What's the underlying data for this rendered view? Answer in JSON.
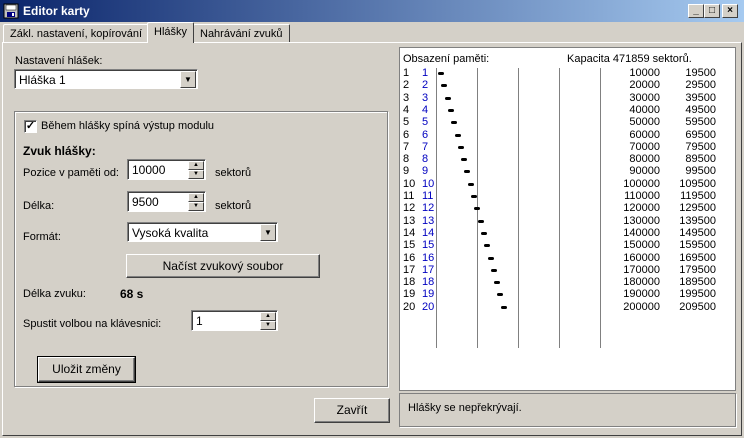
{
  "window": {
    "title": "Editor karty"
  },
  "tabs": [
    {
      "label": "Zákl. nastavení, kopírování"
    },
    {
      "label": "Hlášky"
    },
    {
      "label": "Nahrávání zvuků"
    }
  ],
  "form": {
    "settings_label": "Nastavení hlášek:",
    "settings_value": "Hláška 1",
    "checkbox_label": "Během hlášky spíná výstup modulu",
    "checkbox_checked": true,
    "sound_heading": "Zvuk hlášky:",
    "position_label": "Pozice v paměti od:",
    "position_value": "10000",
    "position_unit": "sektorů",
    "length_label": "Délka:",
    "length_value": "9500",
    "length_unit": "sektorů",
    "format_label": "Formát:",
    "format_value": "Vysoká kvalita",
    "load_button": "Načíst zvukový soubor",
    "duration_label": "Délka zvuku:",
    "duration_value": "68 s",
    "hotkey_label": "Spustit volbou na klávesnici:",
    "hotkey_value": "1",
    "save_button": "Uložit změny"
  },
  "close_button": "Zavřít",
  "memory": {
    "header": "Obsazení paměti:",
    "capacity": "Kapacita 471859 sektorů.",
    "rows": [
      {
        "n": "1",
        "id": "1",
        "start": "10000",
        "end": "19500"
      },
      {
        "n": "2",
        "id": "2",
        "start": "20000",
        "end": "29500"
      },
      {
        "n": "3",
        "id": "3",
        "start": "30000",
        "end": "39500"
      },
      {
        "n": "4",
        "id": "4",
        "start": "40000",
        "end": "49500"
      },
      {
        "n": "5",
        "id": "5",
        "start": "50000",
        "end": "59500"
      },
      {
        "n": "6",
        "id": "6",
        "start": "60000",
        "end": "69500"
      },
      {
        "n": "7",
        "id": "7",
        "start": "70000",
        "end": "79500"
      },
      {
        "n": "8",
        "id": "8",
        "start": "80000",
        "end": "89500"
      },
      {
        "n": "9",
        "id": "9",
        "start": "90000",
        "end": "99500"
      },
      {
        "n": "10",
        "id": "10",
        "start": "100000",
        "end": "109500"
      },
      {
        "n": "11",
        "id": "11",
        "start": "110000",
        "end": "119500"
      },
      {
        "n": "12",
        "id": "12",
        "start": "120000",
        "end": "129500"
      },
      {
        "n": "13",
        "id": "13",
        "start": "130000",
        "end": "139500"
      },
      {
        "n": "14",
        "id": "14",
        "start": "140000",
        "end": "149500"
      },
      {
        "n": "15",
        "id": "15",
        "start": "150000",
        "end": "159500"
      },
      {
        "n": "16",
        "id": "16",
        "start": "160000",
        "end": "169500"
      },
      {
        "n": "17",
        "id": "17",
        "start": "170000",
        "end": "179500"
      },
      {
        "n": "18",
        "id": "18",
        "start": "180000",
        "end": "189500"
      },
      {
        "n": "19",
        "id": "19",
        "start": "190000",
        "end": "199500"
      },
      {
        "n": "20",
        "id": "20",
        "start": "200000",
        "end": "209500"
      }
    ],
    "status": "Hlášky se nepřekrývají."
  },
  "colors": {
    "title_start": "#0a246a",
    "title_end": "#a6caf0",
    "index_blue": "#0000c0"
  }
}
